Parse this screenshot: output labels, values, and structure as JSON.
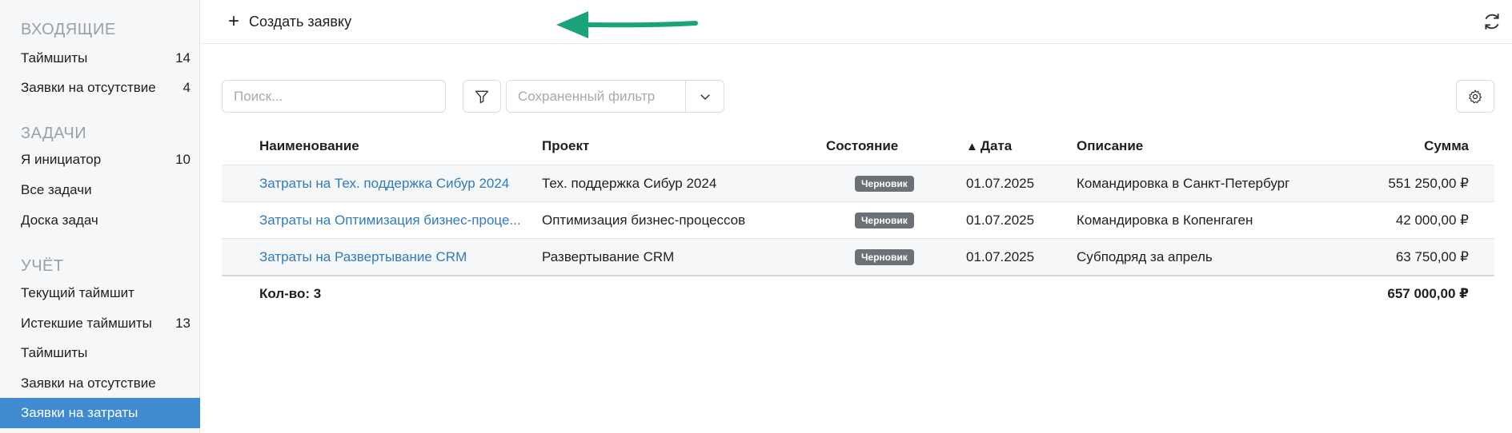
{
  "sidebar": {
    "sections": [
      {
        "title": "ВХОДЯЩИЕ",
        "items": [
          {
            "label": "Таймшиты",
            "count": "14"
          },
          {
            "label": "Заявки на отсутствие",
            "count": "4"
          }
        ]
      },
      {
        "title": "ЗАДАЧИ",
        "items": [
          {
            "label": "Я инициатор",
            "count": "10"
          },
          {
            "label": "Все задачи",
            "count": ""
          },
          {
            "label": "Доска задач",
            "count": ""
          }
        ]
      },
      {
        "title": "УЧЁТ",
        "items": [
          {
            "label": "Текущий таймшит",
            "count": ""
          },
          {
            "label": "Истекшие таймшиты",
            "count": "13"
          },
          {
            "label": "Таймшиты",
            "count": ""
          },
          {
            "label": "Заявки на отсутствие",
            "count": ""
          },
          {
            "label": "Заявки на затраты",
            "count": ""
          }
        ]
      }
    ],
    "active_item": "Заявки на затраты"
  },
  "topbar": {
    "create_label": "Создать заявку",
    "refresh_icon": "refresh-icon",
    "annotation_arrow_color": "#1aa37a"
  },
  "toolbar": {
    "search_placeholder": "Поиск...",
    "filter_icon": "filter-icon",
    "saved_filter_placeholder": "Сохраненный фильтр",
    "settings_icon": "gear-icon"
  },
  "table": {
    "columns": {
      "name": "Наименование",
      "project": "Проект",
      "state": "Состояние",
      "date": "Дата",
      "date_sort": "▲",
      "description": "Описание",
      "sum": "Сумма"
    },
    "rows": [
      {
        "name": "Затраты на Тех. поддержка Сибур 2024",
        "project": "Тех. поддержка Сибур 2024",
        "state": "Черновик",
        "date": "01.07.2025",
        "description": "Командировка в Санкт-Петербург",
        "sum": "551 250,00 ₽"
      },
      {
        "name": "Затраты на Оптимизация бизнес-проце...",
        "project": "Оптимизация бизнес-процессов",
        "state": "Черновик",
        "date": "01.07.2025",
        "description": "Командировка в Копенгаген",
        "sum": "42 000,00 ₽"
      },
      {
        "name": "Затраты на Развертывание CRM",
        "project": "Развертывание CRM",
        "state": "Черновик",
        "date": "01.07.2025",
        "description": "Субподряд за апрель",
        "sum": "63 750,00 ₽"
      }
    ],
    "footer": {
      "count_label": "Кол-во: 3",
      "total": "657 000,00 ₽"
    }
  },
  "colors": {
    "accent": "#3f8ad1",
    "link": "#2f7bbf",
    "badge": "#6c7177"
  }
}
